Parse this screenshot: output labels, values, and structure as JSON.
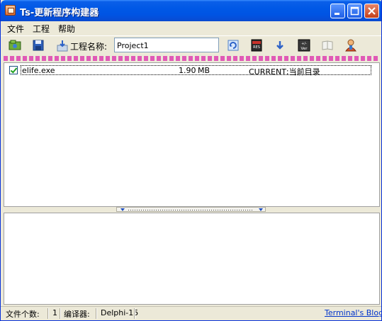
{
  "window": {
    "title": "Ts-更新程序构建器",
    "controls": [
      "minimize-icon",
      "maximize-icon",
      "close-icon"
    ]
  },
  "menu": {
    "items": [
      {
        "label": "文件"
      },
      {
        "label": "工程"
      },
      {
        "label": "帮助"
      }
    ]
  },
  "toolbar": {
    "project_label": "工程名称:",
    "project_name": "Project1",
    "icons": [
      "open-project-icon",
      "save-icon",
      "export-icon",
      "refresh-icon",
      "res-icon",
      "download-icon",
      "version-icon",
      "help-icon",
      "user-icon"
    ]
  },
  "file_list": {
    "rows": [
      {
        "checked": true,
        "name": "elife.exe",
        "size": "1.90",
        "unit": "MB",
        "target": "CURRENT;当前目录"
      }
    ]
  },
  "statusbar": {
    "file_count_label": "文件个数:",
    "file_count": "1",
    "compiler_label": "编译器:",
    "compiler": "Delphi-15",
    "blog_link": "Terminal's Blog"
  },
  "colors": {
    "titlebar": "#0054e3",
    "separator_dots": "#e05ab6",
    "link": "#0033cc",
    "check": "#21a121"
  }
}
